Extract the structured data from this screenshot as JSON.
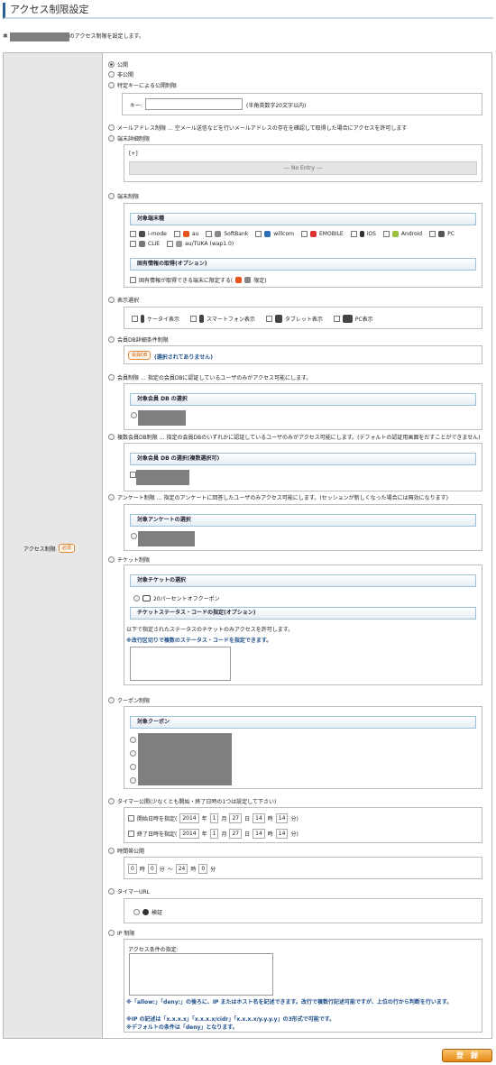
{
  "page": {
    "title": "アクセス制限設定",
    "intro_star": "✱",
    "intro_suffix": "のアクセス制限を設定します。"
  },
  "form": {
    "label": "アクセス制限",
    "required": "必須"
  },
  "options": {
    "public": "公開",
    "private": "非公開",
    "key": "特定キーによる公開制限",
    "key_label": "キー:",
    "key_note": "(半角英数字20文字以内)",
    "mail": "メールアドレス制限 … 空メール送信などを行いメールアドレスの存在を確認して取得した場合にアクセスを許可します",
    "device_detail": "端末詳細制限",
    "plus": "[+]",
    "no_entry": "--- No Entry ---",
    "device": "端末制限",
    "device_head": "対象端末種",
    "device_opt_head": "固有情報の取得(オプション)",
    "device_opt": "固有情報が取得できる端末に限定する(",
    "device_opt_end": "限定)",
    "display": "表示選択",
    "member_db": "会員DB詳細条件制限",
    "db_button": "会員DB",
    "db_note": "(選択されてありません)",
    "member": "会員制限 … 指定の会員DBに認証しているユーザのみがアクセス可能にします。",
    "member_head": "対象会員 DB の選択",
    "multi": "複数会員DB制限 … 指定の会員DBのいずれかに認証しているユーザのみがアクセス可能にします。(デフォルトの認証用画面をだすことができません)",
    "multi_head": "対象会員 DB の選択(複数選択可)",
    "survey": "アンケート制限 … 指定のアンケートに回答したユーザのみアクセス可能にします。(セッションが新しくなった場合には無効になります)",
    "survey_head": "対象アンケートの選択",
    "ticket": "チケット制限",
    "ticket_head": "対象チケットの選択",
    "ticket_item": "20パーセントオフクーポン",
    "ticket_status_head": "チケットステータス・コードの指定(オプション)",
    "ticket_note1": "以下で指定されたステータスのチケットのみアクセスを許可します。",
    "ticket_note2": "※改行区切りで複数のステータス・コードを指定できます。",
    "coupon": "クーポン制限",
    "coupon_head": "対象クーポン",
    "timer": "タイマー公開(少なくとも開始・終了日時の1つは設定して下さい)",
    "start": "開始日時を指定(",
    "end": "終了日時を指定(",
    "timezone": "時間帯公開",
    "timer_url": "タイマーURL",
    "verify": "検証",
    "ip": "IP 制限",
    "ip_cond": "アクセス条件の指定:",
    "ip_note1": "※「allow:」「deny:」の後ろに、IP またはホスト名を記述できます。改行で複数行記述可能ですが、上位の行から判断を行います。",
    "ip_note2": "※IP の記述は「x.x.x.x」「x.x.x.x/cidr」「x.x.x.x/y.y.y.y」の3形式で可能です。",
    "ip_note3": "※デフォルトの条件は「deny」となります。"
  },
  "devices": [
    "i-mode",
    "au",
    "SoftBank",
    "willcom",
    "EMOBILE",
    "iOS",
    "Android",
    "PC",
    "CLIE",
    "au/TUKA (wap1.0)"
  ],
  "display": [
    "ケータイ表示",
    "スマートフォン表示",
    "タブレット表示",
    "PC表示"
  ],
  "date": {
    "year": "2014",
    "month": "1",
    "day": "27",
    "hour": "14",
    "min": "14",
    "y": "年",
    "m": "月",
    "d": "日",
    "h": "時",
    "mi": "分",
    "close": "分)"
  },
  "time": {
    "h1": "0",
    "m1": "0",
    "h2": "24",
    "m2": "0",
    "h": "時",
    "m": "分",
    "sep": "〜"
  },
  "submit": "登　録",
  "colors": {
    "accent": "#2a5f96",
    "button": "#e68a16"
  }
}
